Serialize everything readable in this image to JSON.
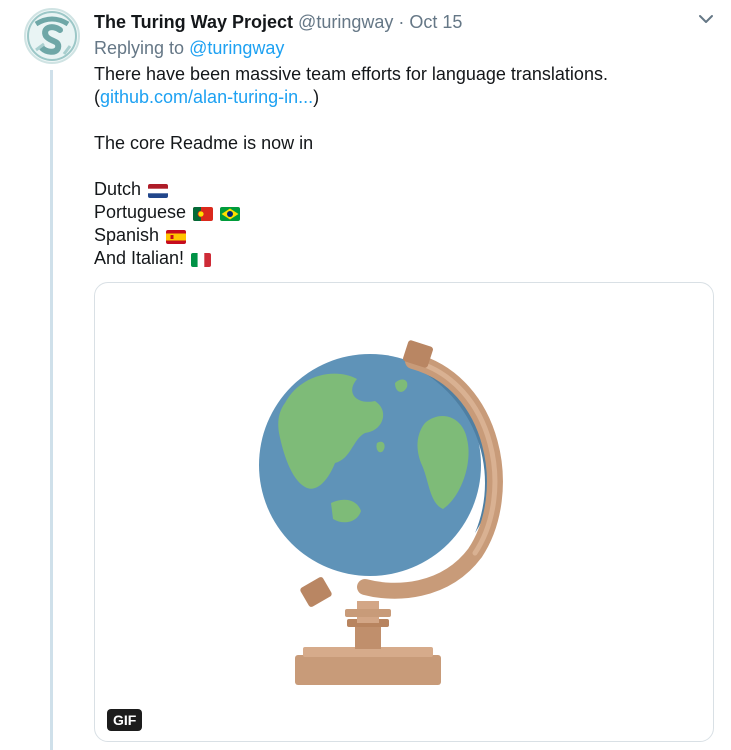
{
  "tweet": {
    "author_name": "The Turing Way Project",
    "handle": "@turingway",
    "separator": "·",
    "date": "Oct 15",
    "replying_prefix": "Replying to",
    "replying_handle": "@turingway",
    "text": {
      "line1": "There have been massive team efforts for language translations.",
      "link_open": "(",
      "link": "github.com/alan-turing-in...",
      "link_close": ")",
      "line3": "The core Readme is now in",
      "lang_dutch": "Dutch",
      "lang_portuguese": "Portuguese",
      "lang_spanish": "Spanish",
      "lang_italian": "And Italian!"
    },
    "flags": [
      "netherlands-flag",
      "portugal-flag",
      "brazil-flag",
      "spain-flag",
      "italy-flag"
    ],
    "media": {
      "badge": "GIF",
      "subject": "globe-icon"
    }
  },
  "colors": {
    "link": "#1da1f2",
    "muted": "#657786",
    "ocean": "#5f93b8",
    "land": "#7ebb78",
    "globe_stand": "#c89b79"
  }
}
